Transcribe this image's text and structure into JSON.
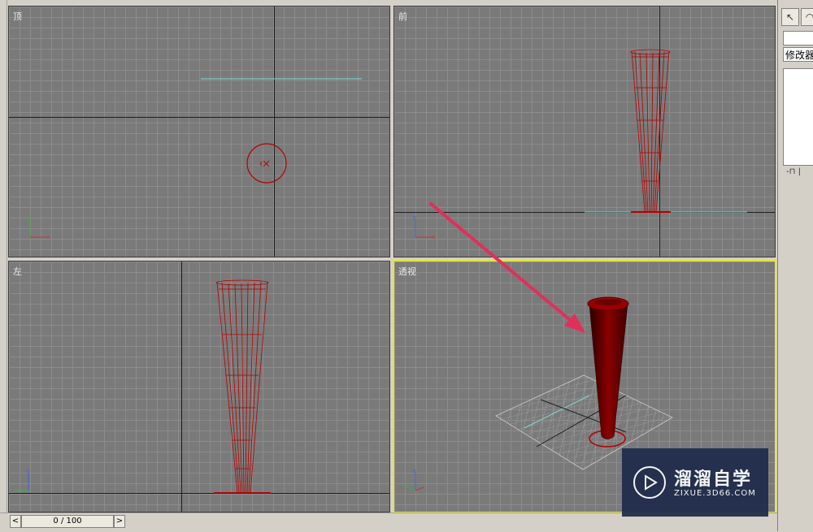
{
  "viewports": {
    "top": {
      "label": "顶"
    },
    "front": {
      "label": "前"
    },
    "left": {
      "label": "左"
    },
    "perspective": {
      "label": "透视"
    }
  },
  "gizmo": {
    "x": "x",
    "y": "y",
    "z": "z"
  },
  "right_panel": {
    "modifier_list_label": "修改器列表",
    "pin_icon": "pin-stack-icon"
  },
  "timeline": {
    "frame_text": "0 / 100",
    "prev_label": "<",
    "next_label": ">"
  },
  "watermark": {
    "title": "溜溜自学",
    "url": "ZIXUE.3D66.COM"
  },
  "colors": {
    "viewport_bg": "#7a7a7a",
    "object_wire": "#b30000",
    "active_border": "#e6e633",
    "arrow": "#e0305a"
  }
}
